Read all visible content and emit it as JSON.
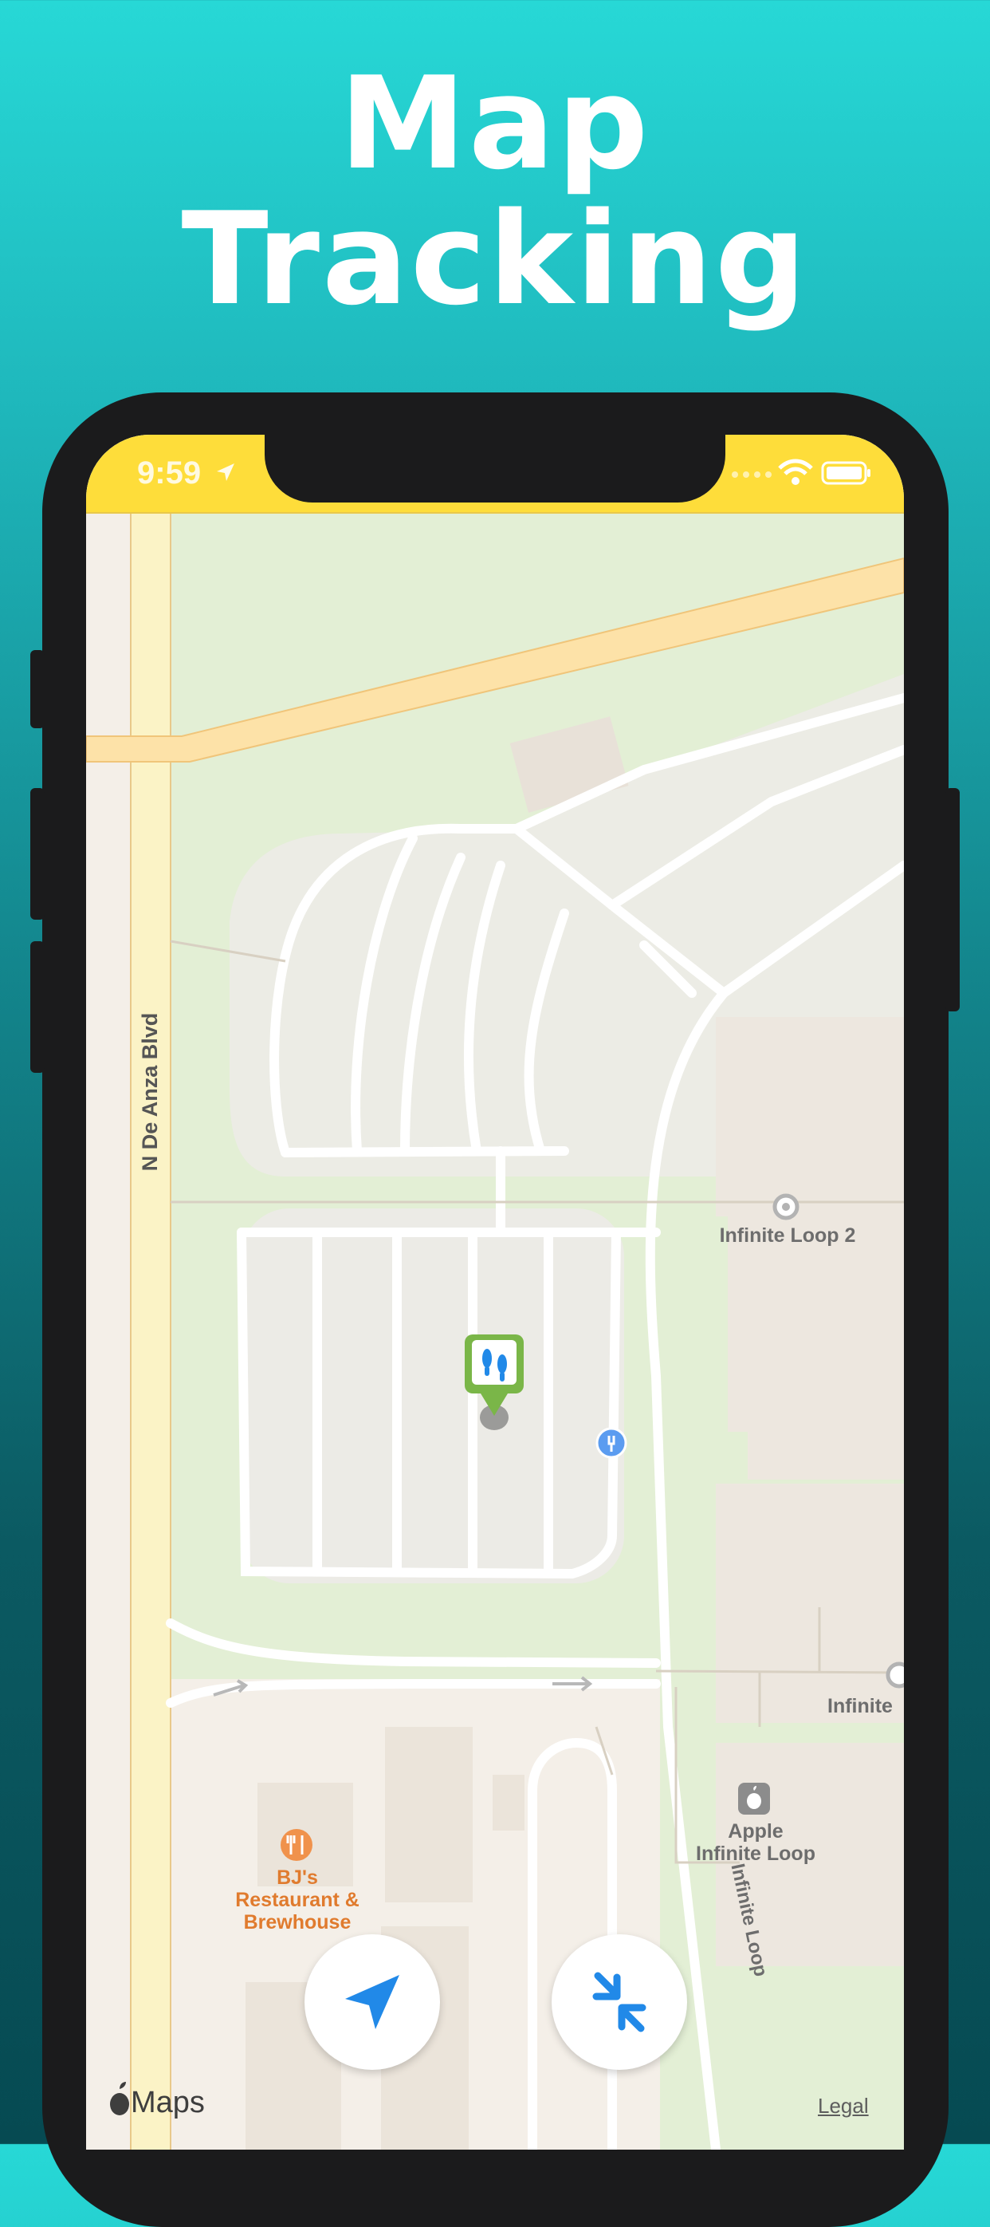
{
  "headline": {
    "line1": "Map",
    "line2": "Tracking"
  },
  "status_bar": {
    "time": "9:59"
  },
  "map": {
    "street_labels": {
      "de_anza": "N De Anza Blvd",
      "infinite_loop_street": "Infinite Loop"
    },
    "pois": {
      "infinite_loop_2": "Infinite Loop 2",
      "infinite_partial": "Infinite",
      "apple_line1": "Apple",
      "apple_line2": "Infinite Loop",
      "bjs_line1": "BJ's",
      "bjs_line2": "Restaurant &",
      "bjs_line3": "Brewhouse"
    },
    "attribution": "Maps",
    "legal": "Legal"
  },
  "buttons": {
    "locate": "navigation-arrow-icon",
    "recenter": "compress-arrows-icon"
  },
  "colors": {
    "status_bar": "#fedd3a",
    "accent_blue": "#2189e8",
    "pin_green": "#7ab648",
    "poi_orange": "#e07b2e",
    "grass": "#e3efd5",
    "urban": "#f4efe8"
  }
}
